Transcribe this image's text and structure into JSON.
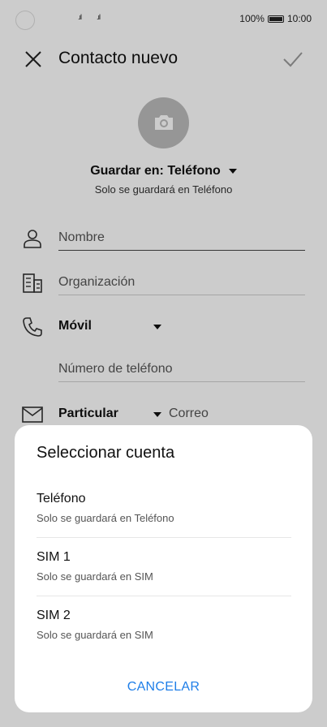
{
  "status_bar": {
    "signal_1": ".ıl",
    "signal_2": ".ıl",
    "battery_percent": "100%",
    "time": "10:00"
  },
  "header": {
    "title": "Contacto nuevo",
    "close_icon": "close-icon",
    "confirm_icon": "check-icon"
  },
  "contact": {
    "photo_icon": "camera-icon",
    "save_in": "Guardar en: Teléfono",
    "save_note": "Solo se guardará en Teléfono"
  },
  "fields": {
    "name_placeholder": "Nombre",
    "organization_placeholder": "Organización",
    "phone_type": "Móvil",
    "phone_placeholder": "Número de teléfono",
    "email_type": "Particular",
    "email_placeholder": "Correo"
  },
  "sheet": {
    "title": "Seleccionar cuenta",
    "options": [
      {
        "title": "Teléfono",
        "subtitle": "Solo se guardará en Teléfono"
      },
      {
        "title": "SIM 1",
        "subtitle": "Solo se guardará en SIM"
      },
      {
        "title": "SIM 2",
        "subtitle": "Solo se guardará en SIM"
      }
    ],
    "cancel": "CANCELAR"
  },
  "colors": {
    "accent": "#1e7ee8",
    "scrim": "#000000"
  }
}
